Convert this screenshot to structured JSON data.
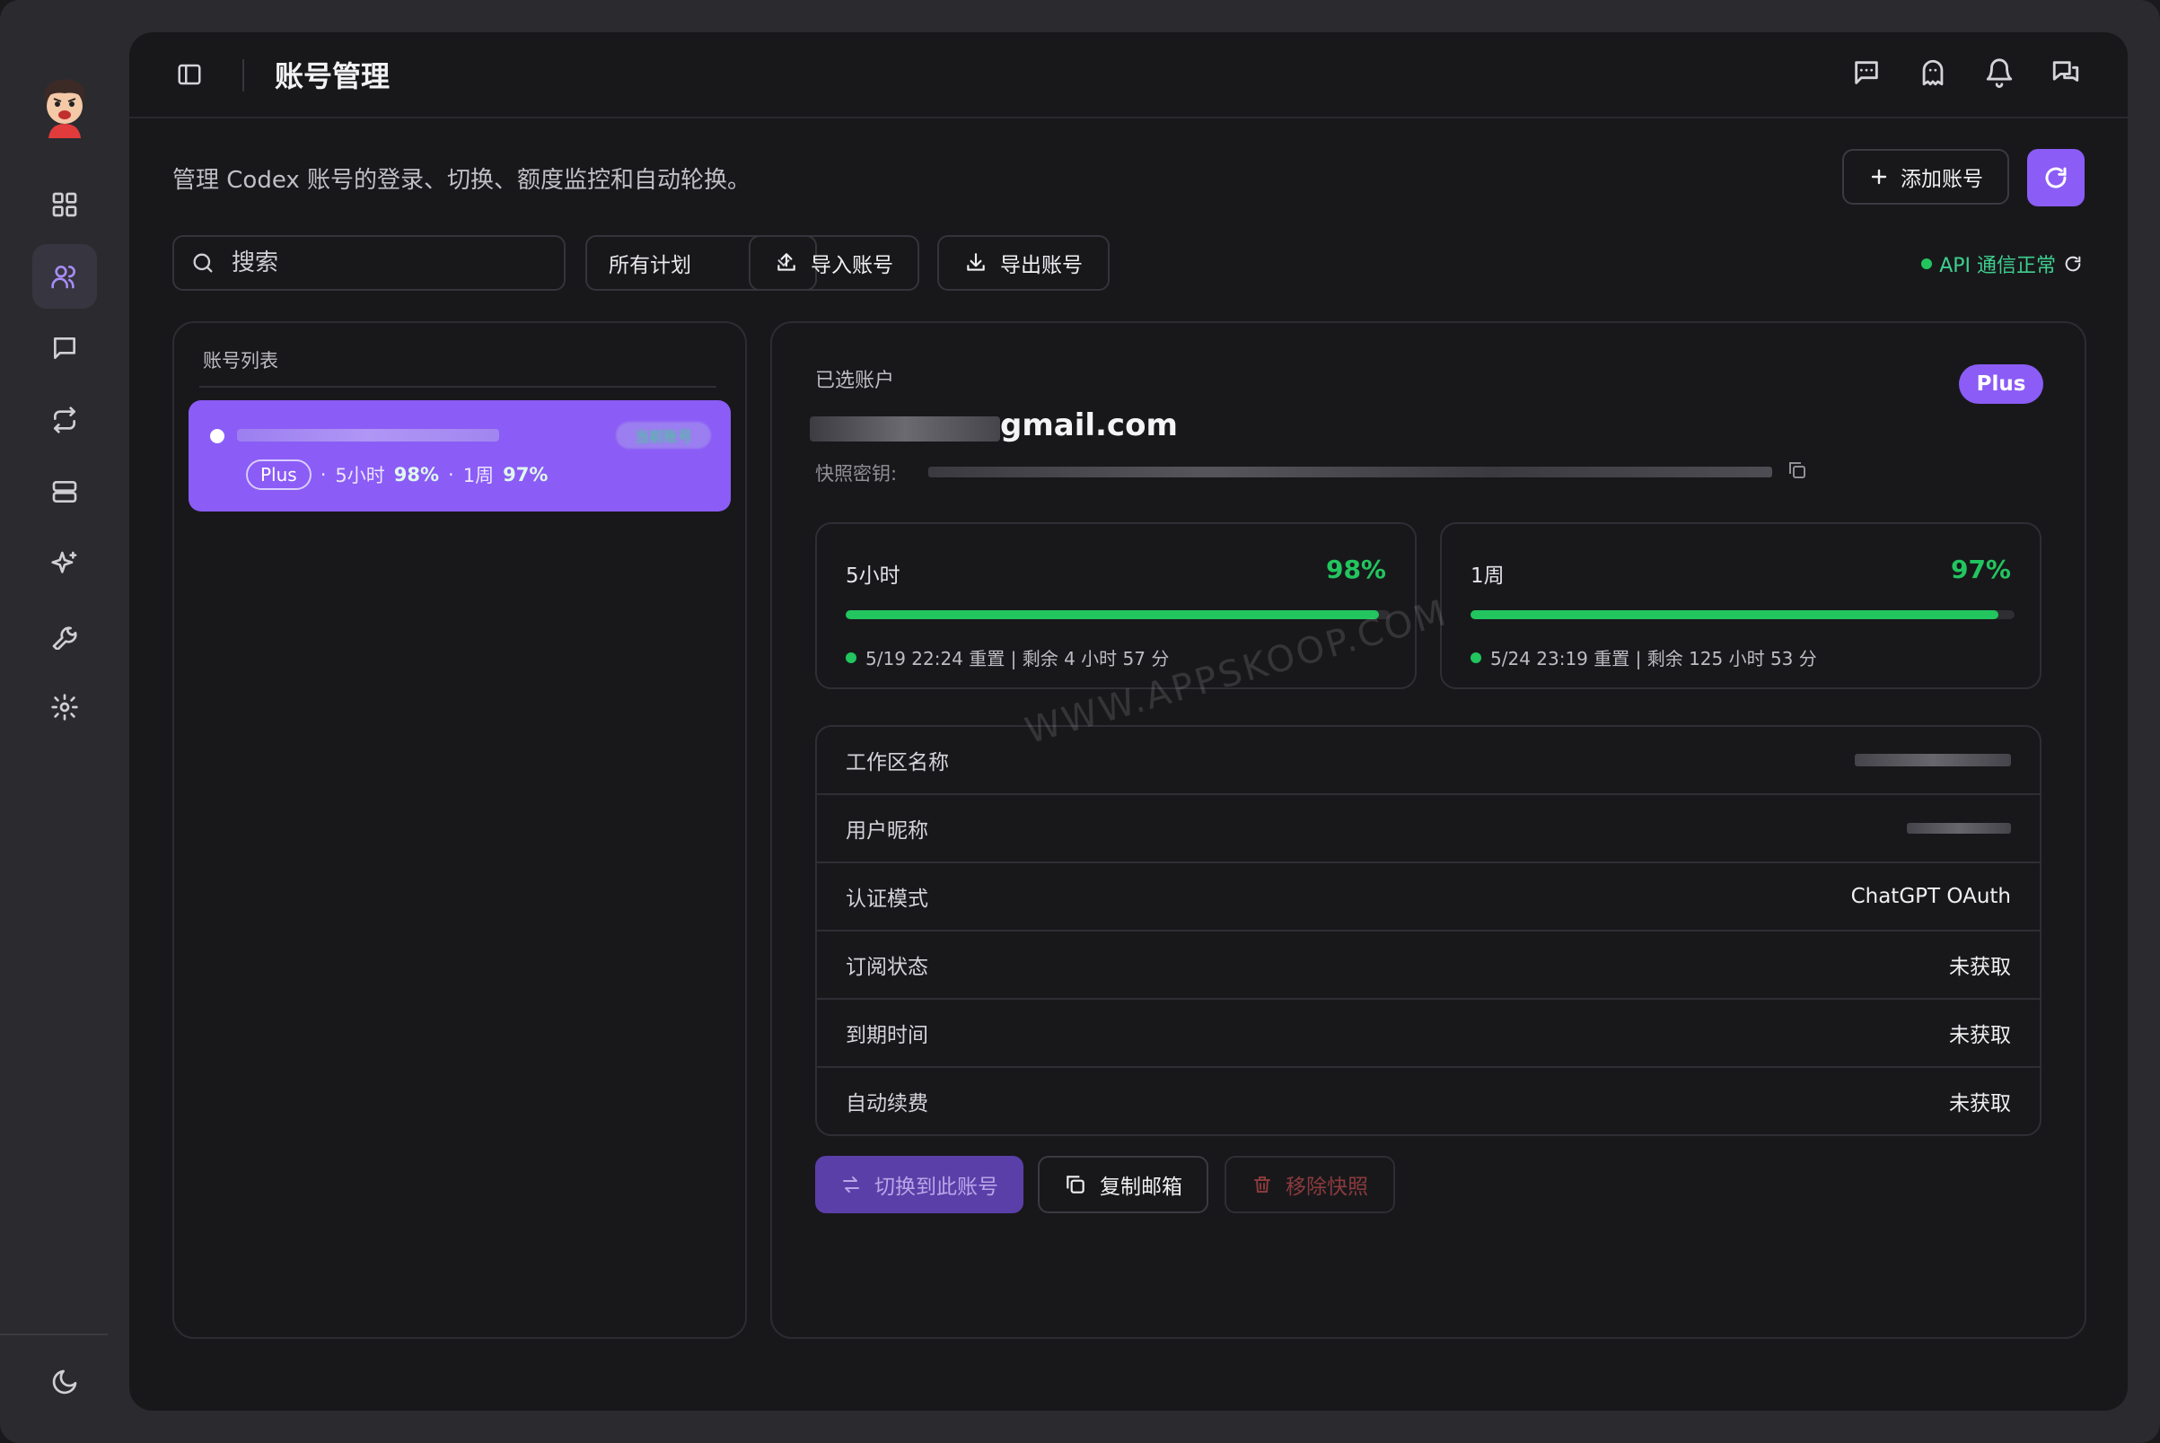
{
  "header": {
    "title": "账号管理",
    "description": "管理 Codex 账号的登录、切换、额度监控和自动轮换。"
  },
  "toolbar": {
    "add_label": "添加账号",
    "search_placeholder": "搜索",
    "plan_filter": "所有计划",
    "import_label": "导入账号",
    "export_label": "导出账号",
    "api_status": "API 通信正常"
  },
  "list": {
    "title": "账号列表",
    "accounts": [
      {
        "plan": "Plus",
        "badge": "当前账号",
        "h5_label": "5小时",
        "h5_pct": "98%",
        "week_label": "1周",
        "week_pct": "97%"
      }
    ]
  },
  "detail": {
    "selected_label": "已选账户",
    "plan_badge": "Plus",
    "email_domain": "gmail.com",
    "snapshot_label": "快照密钥:",
    "quota": [
      {
        "label": "5小时",
        "pct": "98%",
        "fill": 0.98,
        "reset": "5/19 22:24 重置 | 剩余 4 小时 57 分"
      },
      {
        "label": "1周",
        "pct": "97%",
        "fill": 0.97,
        "reset": "5/24 23:19 重置 | 剩余 125 小时 53 分"
      }
    ],
    "rows": [
      {
        "key": "工作区名称",
        "value": ""
      },
      {
        "key": "用户昵称",
        "value": ""
      },
      {
        "key": "认证模式",
        "value": "ChatGPT OAuth"
      },
      {
        "key": "订阅状态",
        "value": "未获取"
      },
      {
        "key": "到期时间",
        "value": "未获取"
      },
      {
        "key": "自动续费",
        "value": "未获取"
      }
    ],
    "actions": {
      "switch_label": "切换到此账号",
      "copy_label": "复制邮箱",
      "remove_label": "移除快照"
    }
  },
  "watermark": "WWW.APPSKOOP.COM",
  "colors": {
    "accent": "#8b5cf6",
    "success": "#22c55e",
    "danger": "#e5484d"
  }
}
